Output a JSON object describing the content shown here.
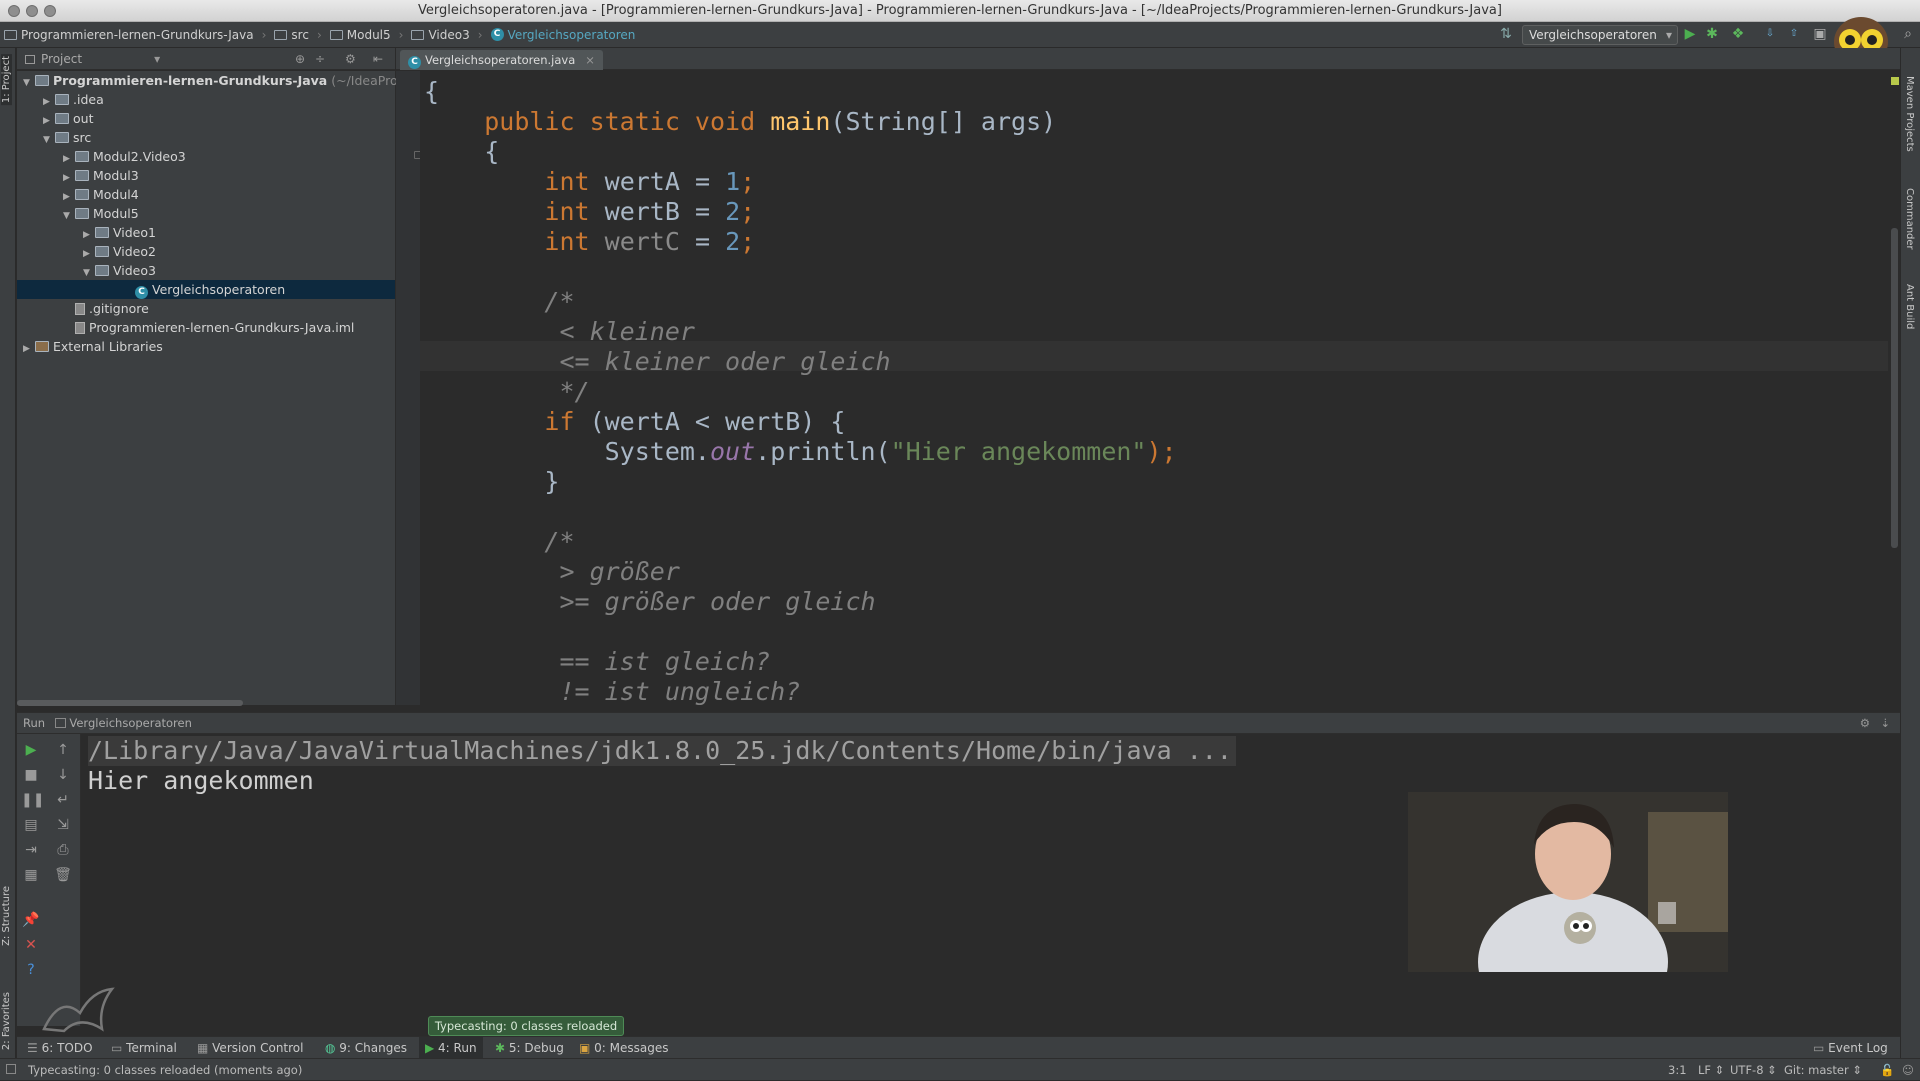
{
  "window": {
    "title": "Vergleichsoperatoren.java - [Programmieren-lernen-Grundkurs-Java] - Programmieren-lernen-Grundkurs-Java - [~/IdeaProjects/Programmieren-lernen-Grundkurs-Java]"
  },
  "breadcrumb": [
    "Programmieren-lernen-Grundkurs-Java",
    "src",
    "Modul5",
    "Video3",
    "Vergleichsoperatoren"
  ],
  "toolbar": {
    "run_config": "Vergleichsoperatoren"
  },
  "side_tabs": {
    "left_top": "1: Project",
    "left_structure": "Z: Structure",
    "left_favorites": "2: Favorites",
    "right": [
      "Maven Projects",
      "Commander",
      "Ant Build"
    ]
  },
  "project": {
    "header": "Project",
    "tree": [
      {
        "label": "Programmieren-lernen-Grundkurs-Java",
        "suffix": "(~/IdeaProject",
        "depth": 0,
        "arrow": "▼",
        "type": "folder",
        "bold": true
      },
      {
        "label": ".idea",
        "depth": 1,
        "arrow": "▶",
        "type": "folder"
      },
      {
        "label": "out",
        "depth": 1,
        "arrow": "▶",
        "type": "folder"
      },
      {
        "label": "src",
        "depth": 1,
        "arrow": "▼",
        "type": "folder"
      },
      {
        "label": "Modul2.Video3",
        "depth": 2,
        "arrow": "▶",
        "type": "folder"
      },
      {
        "label": "Modul3",
        "depth": 2,
        "arrow": "▶",
        "type": "folder"
      },
      {
        "label": "Modul4",
        "depth": 2,
        "arrow": "▶",
        "type": "folder"
      },
      {
        "label": "Modul5",
        "depth": 2,
        "arrow": "▼",
        "type": "folder"
      },
      {
        "label": "Video1",
        "depth": 3,
        "arrow": "▶",
        "type": "folder"
      },
      {
        "label": "Video2",
        "depth": 3,
        "arrow": "▶",
        "type": "folder"
      },
      {
        "label": "Video3",
        "depth": 3,
        "arrow": "▼",
        "type": "folder"
      },
      {
        "label": "Vergleichsoperatoren",
        "depth": 5,
        "arrow": "",
        "type": "class",
        "selected": true
      },
      {
        "label": ".gitignore",
        "depth": 2,
        "arrow": "",
        "type": "file"
      },
      {
        "label": "Programmieren-lernen-Grundkurs-Java.iml",
        "depth": 2,
        "arrow": "",
        "type": "file"
      },
      {
        "label": "External Libraries",
        "depth": 0,
        "arrow": "▶",
        "type": "lib"
      }
    ]
  },
  "editor": {
    "tab": "Vergleichsoperatoren.java",
    "lines": [
      [
        [
          "{",
          ""
        ]
      ],
      [
        [
          "    ",
          ""
        ],
        [
          "public static void ",
          "kw"
        ],
        [
          "main",
          "fn"
        ],
        [
          "(String[] args)",
          ""
        ]
      ],
      [
        [
          "    {",
          ""
        ]
      ],
      [
        [
          "        ",
          ""
        ],
        [
          "int ",
          "kw"
        ],
        [
          "wertA",
          ""
        ],
        [
          " = ",
          ""
        ],
        [
          "1",
          "num"
        ],
        [
          ";",
          "kw"
        ]
      ],
      [
        [
          "        ",
          ""
        ],
        [
          "int ",
          "kw"
        ],
        [
          "wertB",
          ""
        ],
        [
          " = ",
          ""
        ],
        [
          "2",
          "num"
        ],
        [
          ";",
          "kw"
        ]
      ],
      [
        [
          "        ",
          ""
        ],
        [
          "int ",
          "kw"
        ],
        [
          "wertC",
          "unused"
        ],
        [
          " = ",
          ""
        ],
        [
          "2",
          "num"
        ],
        [
          ";",
          "kw"
        ]
      ],
      [
        [
          "",
          ""
        ]
      ],
      [
        [
          "        ",
          ""
        ],
        [
          "/*",
          "cm"
        ]
      ],
      [
        [
          "         ",
          ""
        ],
        [
          "< kleiner",
          "cm"
        ]
      ],
      [
        [
          "         ",
          ""
        ],
        [
          "<= kleiner oder gleich",
          "cm"
        ]
      ],
      [
        [
          "         ",
          ""
        ],
        [
          "*/",
          "cm"
        ]
      ],
      [
        [
          "        ",
          ""
        ],
        [
          "if ",
          "kw"
        ],
        [
          "(wertA < wertB) {",
          ""
        ]
      ],
      [
        [
          "            ",
          ""
        ],
        [
          "System.",
          ""
        ],
        [
          "out",
          "fld"
        ],
        [
          ".println(",
          ""
        ],
        [
          "\"Hier angekommen\"",
          "str"
        ],
        [
          ");",
          "kw"
        ]
      ],
      [
        [
          "        }",
          ""
        ]
      ],
      [
        [
          "",
          ""
        ]
      ],
      [
        [
          "        ",
          ""
        ],
        [
          "/*",
          "cm"
        ]
      ],
      [
        [
          "         ",
          ""
        ],
        [
          "> größer",
          "cm"
        ]
      ],
      [
        [
          "         ",
          ""
        ],
        [
          ">= größer oder gleich",
          "cm"
        ]
      ],
      [
        [
          "",
          ""
        ]
      ],
      [
        [
          "         ",
          ""
        ],
        [
          "== ist gleich?",
          "cm"
        ]
      ],
      [
        [
          "         ",
          ""
        ],
        [
          "!= ist ungleich?",
          "cm"
        ]
      ]
    ]
  },
  "run": {
    "header_label": "Run",
    "config": "Vergleichsoperatoren",
    "console": [
      "/Library/Java/JavaVirtualMachines/jdk1.8.0_25.jdk/Contents/Home/bin/java ...",
      "Hier angekommen"
    ]
  },
  "bottom_tabs": [
    "6: TODO",
    "Terminal",
    "Version Control",
    "9: Changes",
    "4: Run",
    "5: Debug",
    "0: Messages"
  ],
  "event_log": "Event Log",
  "balloon": "Typecasting: 0 classes reloaded",
  "status": {
    "message": "Typecasting: 0 classes reloaded (moments ago)",
    "position": "3:1",
    "line_sep": "LF",
    "encoding": "UTF-8",
    "vcs": "Git: master"
  }
}
